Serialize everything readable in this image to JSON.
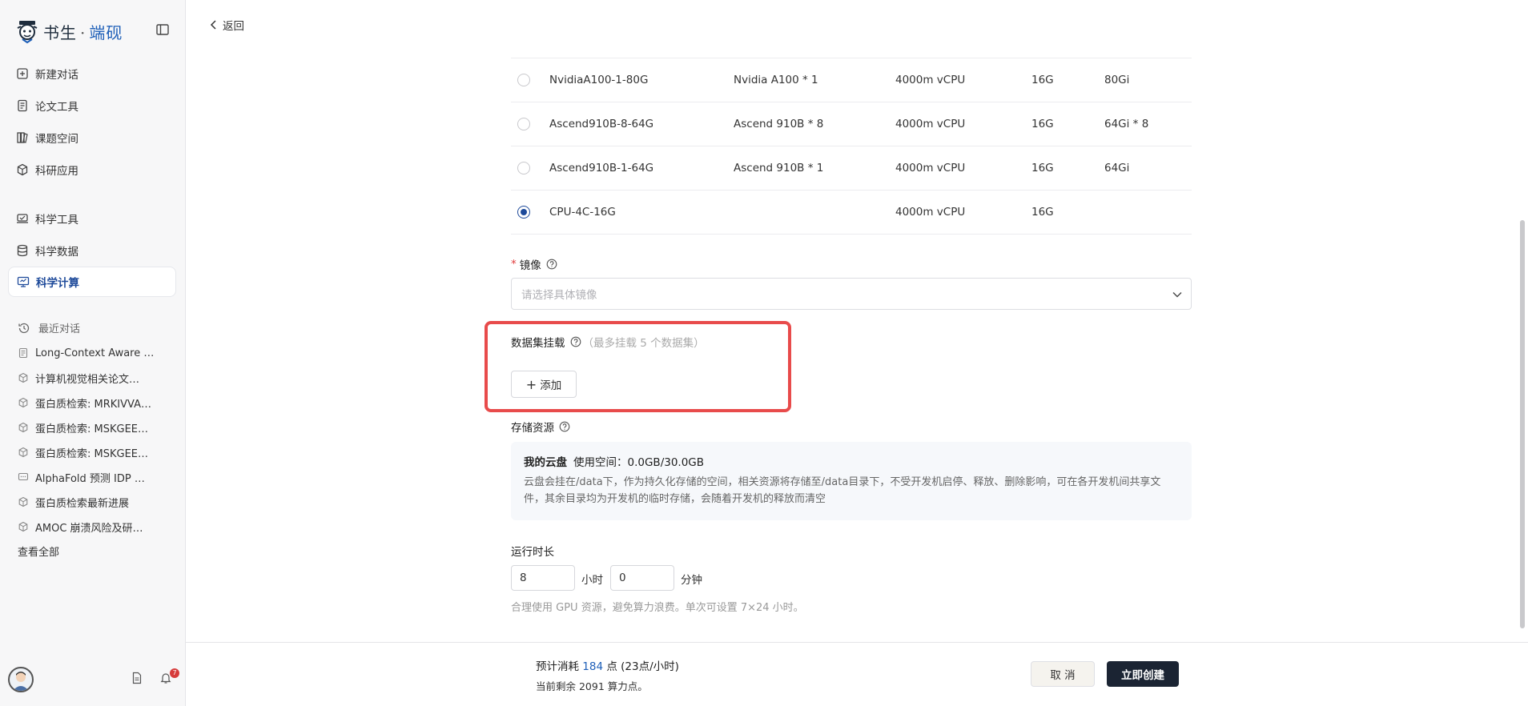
{
  "brand": {
    "name": "书生",
    "separator": "·",
    "product": "端砚"
  },
  "back_label": "返回",
  "nav": {
    "items": [
      {
        "label": "新建对话",
        "icon": "plus-square-icon"
      },
      {
        "label": "论文工具",
        "icon": "document-icon"
      },
      {
        "label": "课题空间",
        "icon": "books-icon"
      },
      {
        "label": "科研应用",
        "icon": "cube-icon"
      },
      {
        "label": "科学工具",
        "icon": "tools-icon"
      },
      {
        "label": "科学数据",
        "icon": "database-icon"
      },
      {
        "label": "科学计算",
        "icon": "monitor-icon",
        "active": true
      }
    ]
  },
  "recent": {
    "heading": "最近对话",
    "items": [
      {
        "label": "Long-Context Aware …",
        "icon": "document-icon"
      },
      {
        "label": "计算机视觉相关论文…",
        "icon": "cube-icon"
      },
      {
        "label": "蛋白质检索: MRKIVVA…",
        "icon": "cube-icon"
      },
      {
        "label": "蛋白质检索: MSKGEE…",
        "icon": "cube-icon"
      },
      {
        "label": "蛋白质检索: MSKGEE…",
        "icon": "cube-icon"
      },
      {
        "label": "AlphaFold 预测 IDP …",
        "icon": "chat-icon"
      },
      {
        "label": "蛋白质检索最新进展",
        "icon": "cube-icon"
      },
      {
        "label": "AMOC 崩溃风险及研…",
        "icon": "cube-icon"
      }
    ],
    "view_all": "查看全部"
  },
  "notifications_count": "7",
  "resources": {
    "rows": [
      {
        "name": "NvidiaA100-1-80G",
        "gpu": "Nvidia A100 * 1",
        "cpu": "4000m vCPU",
        "mem": "16G",
        "vram": "80Gi",
        "selected": false
      },
      {
        "name": "Ascend910B-8-64G",
        "gpu": "Ascend 910B * 8",
        "cpu": "4000m vCPU",
        "mem": "16G",
        "vram": "64Gi * 8",
        "selected": false
      },
      {
        "name": "Ascend910B-1-64G",
        "gpu": "Ascend 910B * 1",
        "cpu": "4000m vCPU",
        "mem": "16G",
        "vram": "64Gi",
        "selected": false
      },
      {
        "name": "CPU-4C-16G",
        "gpu": "",
        "cpu": "4000m vCPU",
        "mem": "16G",
        "vram": "",
        "selected": true
      }
    ]
  },
  "image": {
    "required_mark": "*",
    "label": "镜像",
    "placeholder": "请选择具体镜像"
  },
  "dataset": {
    "label": "数据集挂载",
    "hint": "（最多挂载 5 个数据集）",
    "add_label": "添加"
  },
  "storage": {
    "label": "存储资源",
    "title": "我的云盘",
    "usage": "使用空间：0.0GB/30.0GB",
    "desc": "云盘会挂在/data下，作为持久化存储的空间，相关资源将存储至/data目录下，不受开发机启停、释放、删除影响，可在各开发机间共享文件，其余目录均为开发机的临时存储，会随着开发机的释放而清空"
  },
  "runtime": {
    "label": "运行时长",
    "hours": "8",
    "hours_unit": "小时",
    "minutes": "0",
    "minutes_unit": "分钟",
    "hint": "合理使用 GPU 资源，避免算力浪费。单次可设置 7×24 小时。"
  },
  "footer": {
    "cost_prefix": "预计消耗",
    "cost_value": "184",
    "cost_suffix": "点 (23点/小时)",
    "remaining": "当前剩余 2091 算力点。",
    "cancel": "取 消",
    "create": "立即创建"
  },
  "colors": {
    "accent": "#1e4a9a",
    "highlight": "#e84b4b",
    "primary_button": "#1b2433"
  }
}
